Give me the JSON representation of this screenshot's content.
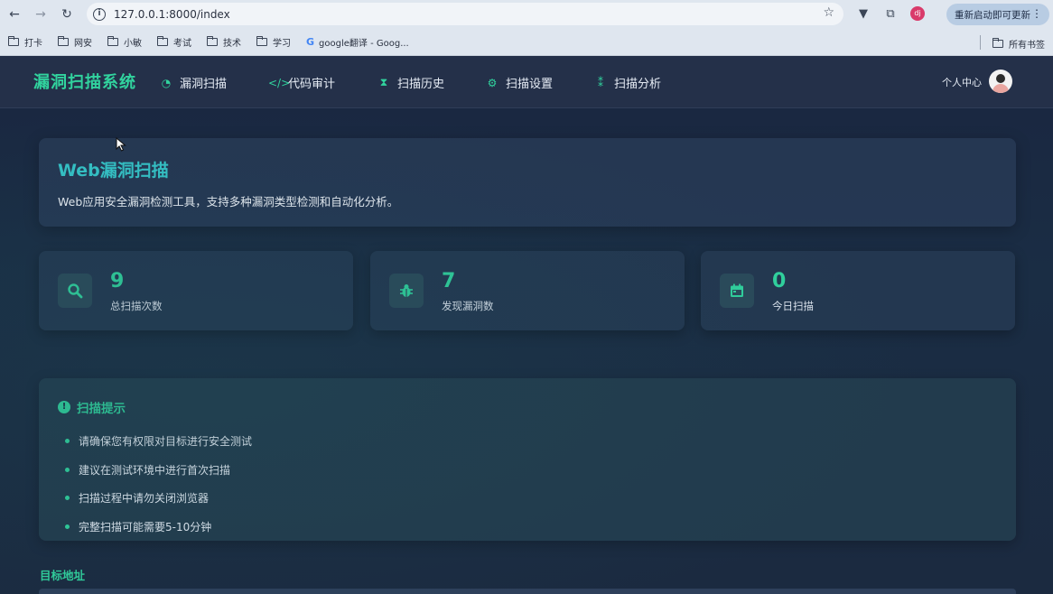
{
  "browser": {
    "url": "127.0.0.1:8000/index",
    "relaunch_label": "重新启动即可更新",
    "profile_initial": "dj",
    "bookmarks": [
      "打卡",
      "网安",
      "小敏",
      "考试",
      "技术",
      "学习",
      "google翻译 - Goog..."
    ],
    "all_bookmarks_label": "所有书签"
  },
  "app": {
    "brand": "漏洞扫描系统",
    "nav": [
      {
        "label": "漏洞扫描",
        "icon": "gauge-icon"
      },
      {
        "label": "代码审计",
        "icon": "code-icon"
      },
      {
        "label": "扫描历史",
        "icon": "hourglass-icon"
      },
      {
        "label": "扫描设置",
        "icon": "gear-icon"
      },
      {
        "label": "扫描分析",
        "icon": "chart-icon"
      }
    ],
    "user_label": "个人中心"
  },
  "hero": {
    "title": "Web漏洞扫描",
    "description": "Web应用安全漏洞检测工具，支持多种漏洞类型检测和自动化分析。"
  },
  "stats": [
    {
      "value": "9",
      "label": "总扫描次数",
      "icon": "search-icon"
    },
    {
      "value": "7",
      "label": "发现漏洞数",
      "icon": "bug-icon"
    },
    {
      "value": "0",
      "label": "今日扫描",
      "icon": "calendar-icon"
    }
  ],
  "tips": {
    "title": "扫描提示",
    "items": [
      "请确保您有权限对目标进行安全测试",
      "建议在测试环境中进行首次扫描",
      "扫描过程中请勿关闭浏览器",
      "完整扫描可能需要5-10分钟"
    ]
  },
  "form": {
    "target_label": "目标地址"
  },
  "colors": {
    "accent": "#31d39e",
    "title_cyan": "#35c4c8",
    "nav_bg": "#243049"
  }
}
